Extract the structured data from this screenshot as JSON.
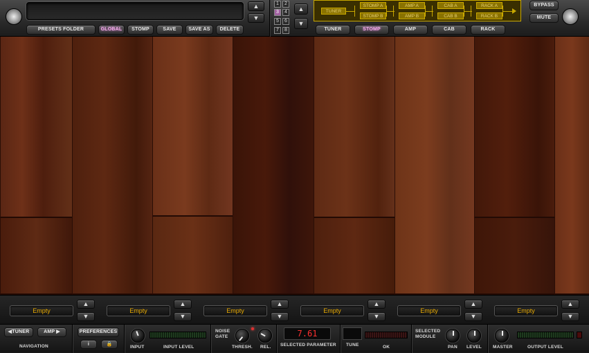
{
  "header": {
    "preset_name": "",
    "buttons": {
      "presets_folder": "PRESETS FOLDER",
      "global": "GLOBAL",
      "stomp": "STOMP",
      "save": "SAVE",
      "save_as": "SAVE AS",
      "delete": "DELETE"
    },
    "preset_numbers": [
      "1",
      "2",
      "3",
      "4",
      "5",
      "6",
      "7",
      "8"
    ],
    "selected_preset_number": "3"
  },
  "signal_chain": {
    "tuner": "TUNER",
    "stomp_a": "STOMP A",
    "stomp_b": "STOMP B",
    "amp_a": "AMP A",
    "amp_b": "AMP B",
    "cab_a": "CAB A",
    "cab_b": "CAB B",
    "rack_a": "RACK A",
    "rack_b": "RACK B"
  },
  "module_tabs": [
    {
      "label": "TUNER",
      "active": false
    },
    {
      "label": "STOMP",
      "active": true
    },
    {
      "label": "AMP",
      "active": false
    },
    {
      "label": "CAB",
      "active": false
    },
    {
      "label": "RACK",
      "active": false
    }
  ],
  "right_buttons": {
    "bypass": "BYPASS",
    "mute": "MUTE"
  },
  "slots": [
    "Empty",
    "Empty",
    "Empty",
    "Empty",
    "Empty",
    "Empty"
  ],
  "bottom": {
    "nav": {
      "tuner": "TUNER",
      "amp": "AMP",
      "label": "NAVIGATION"
    },
    "preferences": "PREFERENCES",
    "input_label": "INPUT",
    "input_level_label": "INPUT LEVEL",
    "noise_gate_label_1": "NOISE",
    "noise_gate_label_2": "GATE",
    "thresh_label": "THRESH.",
    "rel_label": "REL.",
    "selected_parameter_value": "7.61",
    "selected_parameter_label": "SELECTED PARAMETER",
    "tune_label": "TUNE",
    "ok_label": "OK",
    "selected_module_label_1": "SELECTED",
    "selected_module_label_2": "MODULE",
    "pan_label": "PAN",
    "level_label": "LEVEL",
    "master_label": "MASTER",
    "output_level_label": "OUTPUT LEVEL"
  },
  "colors": {
    "accent_text": "#e6a800",
    "chain_yellow": "#c9a800",
    "active_pink": "#e070d8",
    "display_red": "#ff3030"
  }
}
